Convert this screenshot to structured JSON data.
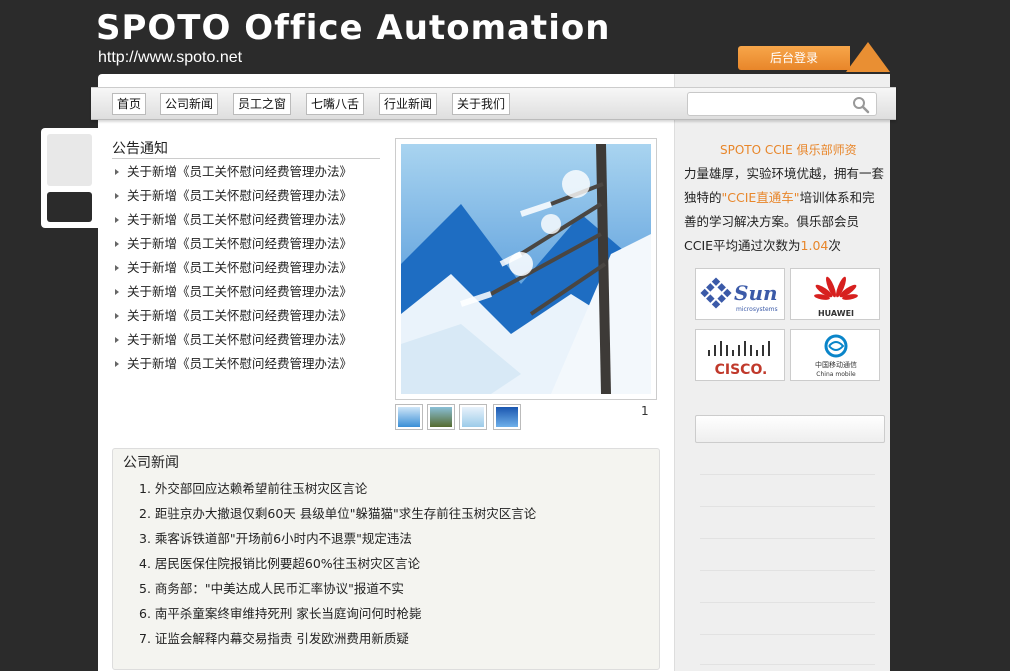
{
  "header": {
    "title": "SPOTO Office Automation",
    "url": "http://www.spoto.net",
    "login_label": "后台登录"
  },
  "nav": {
    "items": [
      "首页",
      "公司新闻",
      "员工之窗",
      "七嘴八舌",
      "行业新闻",
      "关于我们"
    ],
    "search_placeholder": ""
  },
  "notice": {
    "title": "公告通知",
    "items": [
      "关于新增《员工关怀慰问经费管理办法》",
      "关于新增《员工关怀慰问经费管理办法》",
      "关于新增《员工关怀慰问经费管理办法》",
      "关于新增《员工关怀慰问经费管理办法》",
      "关于新增《员工关怀慰问经费管理办法》",
      "关于新增《员工关怀慰问经费管理办法》",
      "关于新增《员工关怀慰问经费管理办法》",
      "关于新增《员工关怀慰问经费管理办法》",
      "关于新增《员工关怀慰问经费管理办法》"
    ]
  },
  "slideshow": {
    "page": "1"
  },
  "news": {
    "title": "公司新闻",
    "items": [
      "1. 外交部回应达赖希望前往玉树灾区言论",
      "2. 距驻京办大撤退仅剩60天 县级单位\"躲猫猫\"求生存前往玉树灾区言论",
      "3. 乘客诉铁道部\"开场前6小时内不退票\"规定违法",
      "4. 居民医保住院报销比例要超60%往玉树灾区言论",
      "5. 商务部：\"中美达成人民币汇率协议\"报道不实",
      "6. 南平杀童案终审维持死刑 家长当庭询问何时枪毙",
      "7. 证监会解释内幕交易指责 引发欧洲费用新质疑"
    ]
  },
  "club": {
    "title": "SPOTO CCIE 俱乐部师资",
    "text_a": "力量雄厚，实验环境优越，拥有一套独特的",
    "text_b": "\"CCIE直通车\"",
    "text_c": "培训体系和完善的学习解决方案。俱乐部会员CCIE平均通过次数为",
    "text_d": "1.04",
    "text_e": "次"
  },
  "partners": {
    "sun": "Sun",
    "sun_sub": "microsystems",
    "huawei": "HUAWEI",
    "cisco": "CISCO.",
    "mobile_cn": "中国移动通信",
    "mobile_en": "China mobile"
  },
  "colors": {
    "accent": "#e8862a",
    "background": "#2b2b2b"
  }
}
